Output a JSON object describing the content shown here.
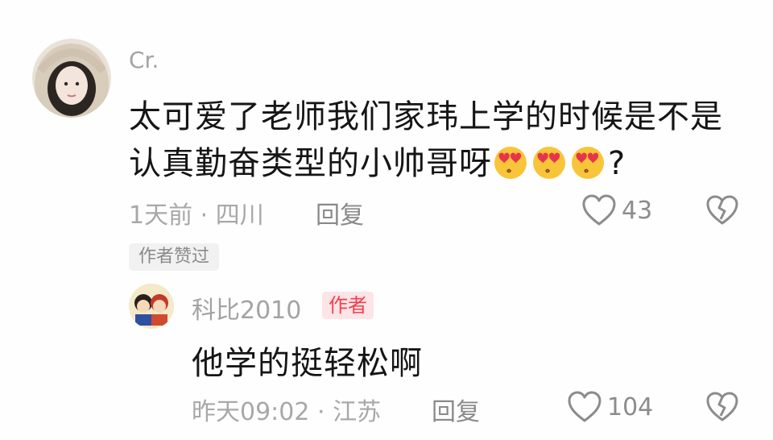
{
  "comment": {
    "username": "Cr.",
    "text_line1": "太可爱了老师我们家玮上学的时候是不是",
    "text_line2": "认真勤奋类型的小帅哥呀",
    "text_tail": "?",
    "emojis": [
      "heart-eyes-emoji",
      "heart-eyes-emoji",
      "heart-eyes-emoji"
    ],
    "meta": "1天前 · 四川",
    "reply_label": "回复",
    "like_count": "43",
    "liked_badge": "作者赞过"
  },
  "reply": {
    "username": "科比2010",
    "author_badge": "作者",
    "text": "他学的挺轻松啊",
    "meta": "昨天09:02 · 江苏",
    "reply_label": "回复",
    "like_count": "104"
  },
  "colors": {
    "username": "#a3a3a3",
    "text": "#151515",
    "meta": "#a8a8a8",
    "author_badge_bg": "#fde4e6",
    "author_badge_text": "#f2404f",
    "liked_badge_bg": "#f1f1f1"
  }
}
